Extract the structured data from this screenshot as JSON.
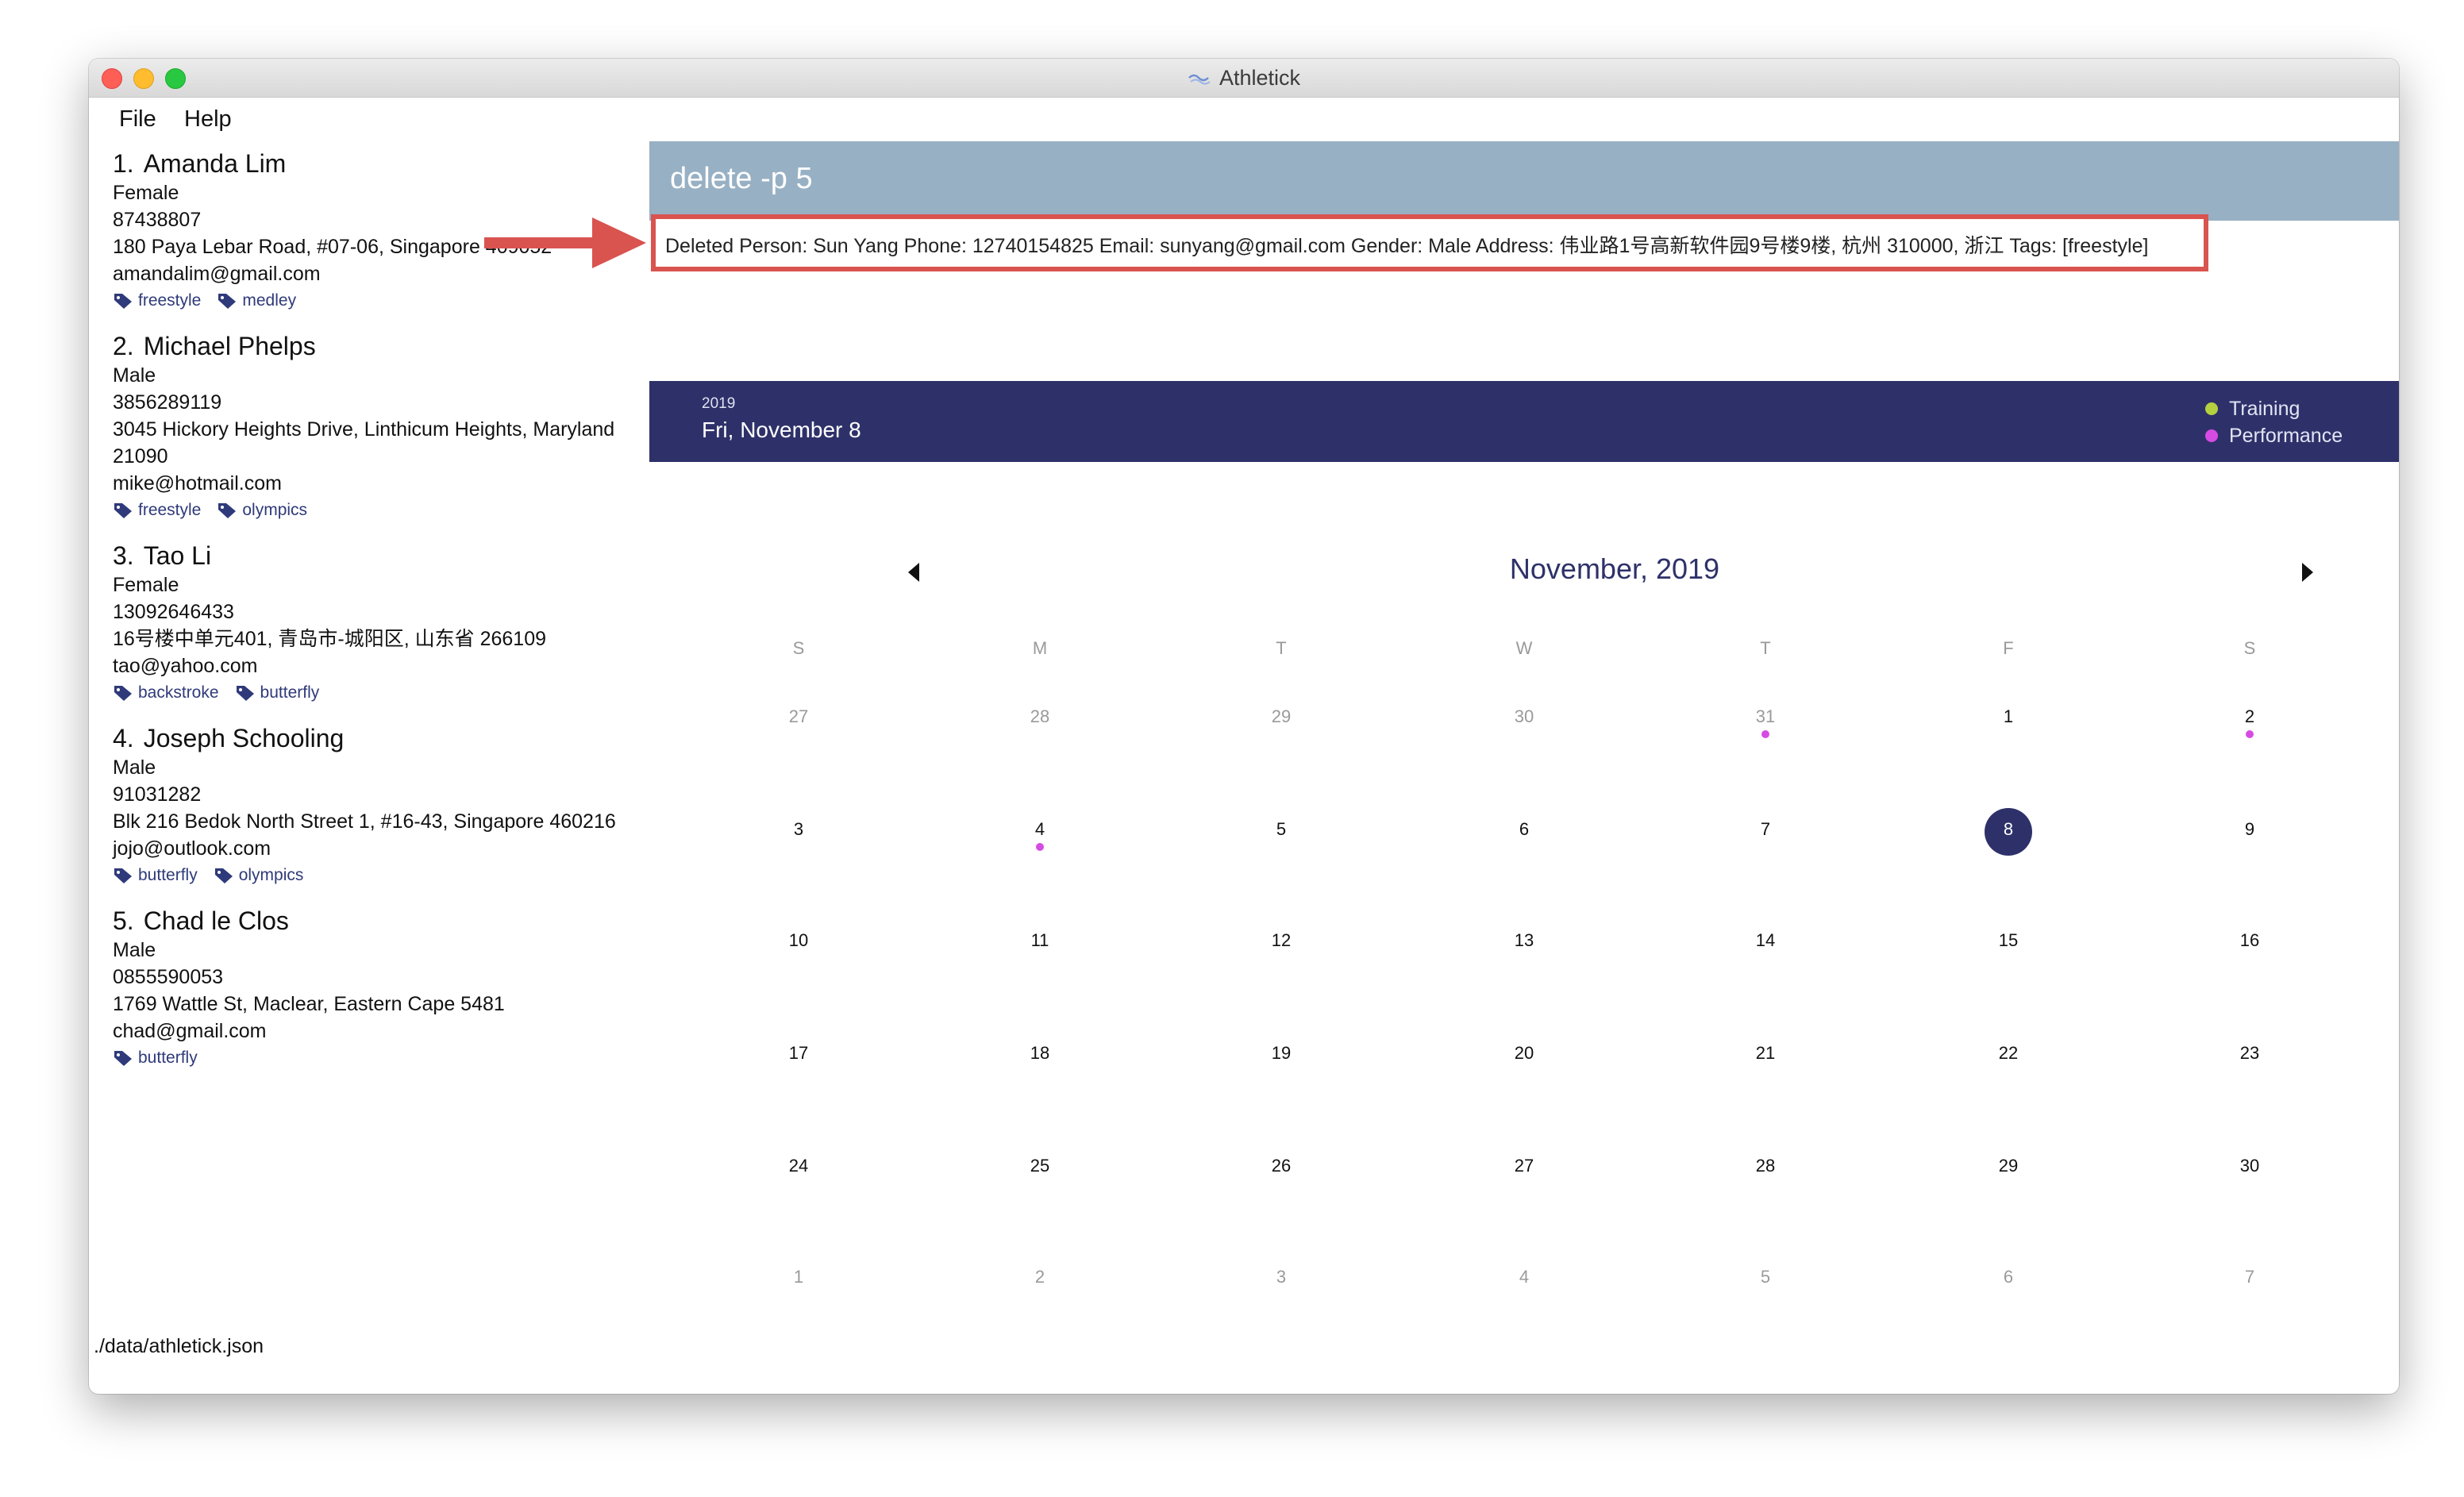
{
  "window": {
    "title": "Athletick"
  },
  "menu": {
    "file": "File",
    "help": "Help"
  },
  "people": [
    {
      "index": "1.",
      "name": "Amanda Lim",
      "gender": "Female",
      "phone": "87438807",
      "address": "180 Paya Lebar Road, #07-06, Singapore 409052",
      "email": "amandalim@gmail.com",
      "tags": [
        "freestyle",
        "medley"
      ]
    },
    {
      "index": "2.",
      "name": "Michael Phelps",
      "gender": "Male",
      "phone": "3856289119",
      "address": "3045 Hickory Heights Drive, Linthicum Heights, Maryland",
      "address2": "21090",
      "email": "mike@hotmail.com",
      "tags": [
        "freestyle",
        "olympics"
      ]
    },
    {
      "index": "3.",
      "name": "Tao Li",
      "gender": "Female",
      "phone": "13092646433",
      "address": "16号楼中单元401, 青岛市-城阳区, 山东省 266109",
      "email": "tao@yahoo.com",
      "tags": [
        "backstroke",
        "butterfly"
      ]
    },
    {
      "index": "4.",
      "name": "Joseph Schooling",
      "gender": "Male",
      "phone": "91031282",
      "address": "Blk 216 Bedok North Street 1, #16-43, Singapore 460216",
      "email": "jojo@outlook.com",
      "tags": [
        "butterfly",
        "olympics"
      ]
    },
    {
      "index": "5.",
      "name": "Chad le Clos",
      "gender": "Male",
      "phone": "0855590053",
      "address": "1769 Wattle St, Maclear, Eastern Cape 5481",
      "email": "chad@gmail.com",
      "tags": [
        "butterfly"
      ]
    }
  ],
  "status": {
    "path": "./data/athletick.json"
  },
  "command": {
    "text": "delete -p 5"
  },
  "result": {
    "text": "Deleted Person: Sun Yang Phone: 12740154825 Email: sunyang@gmail.com Gender: Male Address: 伟业路1号高新软件园9号楼9楼, 杭州 310000, 浙江 Tags: [freestyle]"
  },
  "calendar_header": {
    "year": "2019",
    "date": "Fri, November 8",
    "legend": [
      {
        "label": "Training",
        "color": "#b5d13f"
      },
      {
        "label": "Performance",
        "color": "#d64be3"
      }
    ]
  },
  "calendar": {
    "month_title": "November, 2019",
    "weekdays": [
      "S",
      "M",
      "T",
      "W",
      "T",
      "F",
      "S"
    ],
    "weeks": [
      [
        {
          "d": "27",
          "dim": true
        },
        {
          "d": "28",
          "dim": true
        },
        {
          "d": "29",
          "dim": true
        },
        {
          "d": "30",
          "dim": true
        },
        {
          "d": "31",
          "dim": true,
          "event": "performance"
        },
        {
          "d": "1"
        },
        {
          "d": "2",
          "event": "performance"
        }
      ],
      [
        {
          "d": "3"
        },
        {
          "d": "4",
          "event": "performance"
        },
        {
          "d": "5"
        },
        {
          "d": "6"
        },
        {
          "d": "7"
        },
        {
          "d": "8",
          "selected": true
        },
        {
          "d": "9"
        }
      ],
      [
        {
          "d": "10"
        },
        {
          "d": "11"
        },
        {
          "d": "12"
        },
        {
          "d": "13"
        },
        {
          "d": "14"
        },
        {
          "d": "15"
        },
        {
          "d": "16"
        }
      ],
      [
        {
          "d": "17"
        },
        {
          "d": "18"
        },
        {
          "d": "19"
        },
        {
          "d": "20"
        },
        {
          "d": "21"
        },
        {
          "d": "22"
        },
        {
          "d": "23"
        }
      ],
      [
        {
          "d": "24"
        },
        {
          "d": "25"
        },
        {
          "d": "26"
        },
        {
          "d": "27"
        },
        {
          "d": "28"
        },
        {
          "d": "29"
        },
        {
          "d": "30"
        }
      ],
      [
        {
          "d": "1",
          "dim": true
        },
        {
          "d": "2",
          "dim": true
        },
        {
          "d": "3",
          "dim": true
        },
        {
          "d": "4",
          "dim": true
        },
        {
          "d": "5",
          "dim": true
        },
        {
          "d": "6",
          "dim": true
        },
        {
          "d": "7",
          "dim": true
        }
      ]
    ]
  },
  "icons": {
    "tag": "tag-icon",
    "prev": "triangle-left-icon",
    "next": "triangle-right-icon",
    "app": "athletick-icon",
    "annotation": "red-arrow-icon"
  }
}
